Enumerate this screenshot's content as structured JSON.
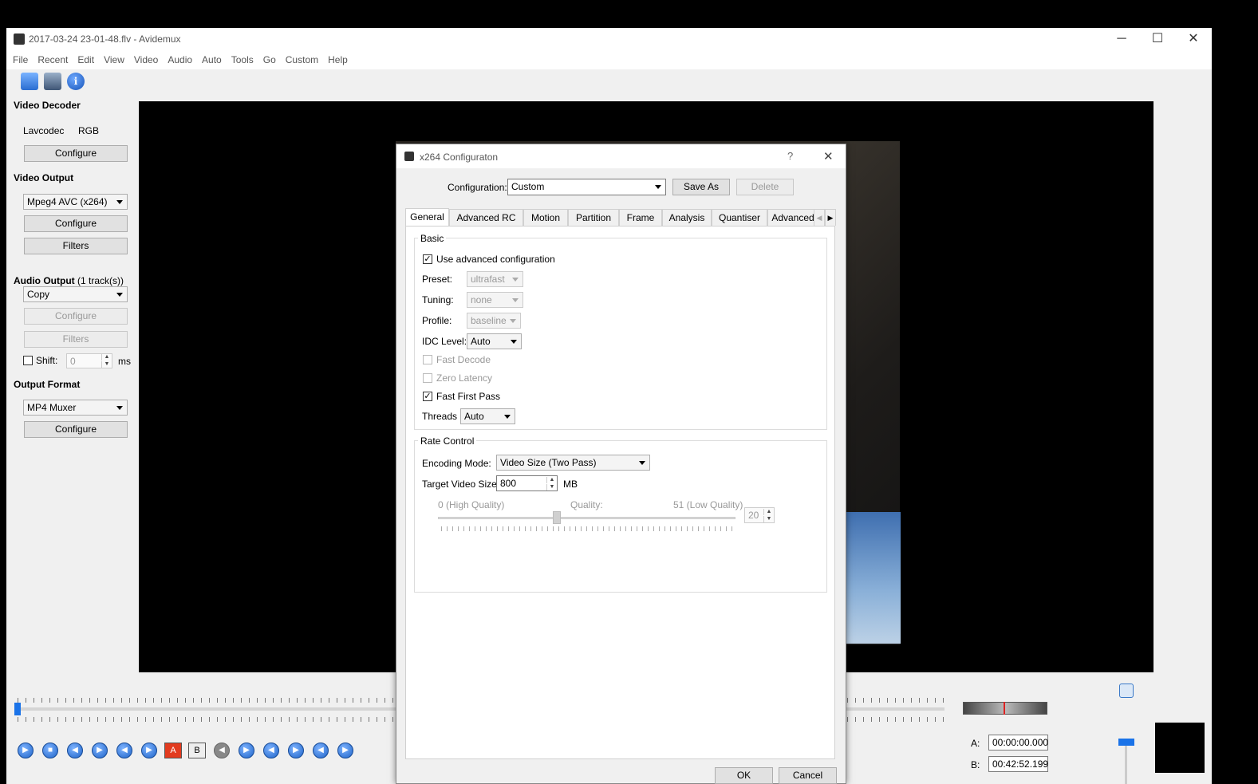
{
  "window": {
    "title": "2017-03-24 23-01-48.flv - Avidemux",
    "controls": [
      "─",
      "☐",
      "✕"
    ]
  },
  "menu": [
    "File",
    "Recent",
    "Edit",
    "View",
    "Video",
    "Audio",
    "Auto",
    "Tools",
    "Go",
    "Custom",
    "Help"
  ],
  "toolbar": {
    "icons": [
      "open-icon",
      "save-icon",
      "info-icon"
    ],
    "info_glyph": "i"
  },
  "left_panel": {
    "video_decoder": {
      "heading": "Video Decoder",
      "codec": "Lavcodec",
      "format": "RGB",
      "configure": "Configure"
    },
    "video_output": {
      "heading": "Video Output",
      "codec": "Mpeg4 AVC (x264)",
      "configure": "Configure",
      "filters": "Filters"
    },
    "audio_output": {
      "heading": "Audio Output",
      "tracks": "(1 track(s))",
      "codec": "Copy",
      "configure": "Configure",
      "filters": "Filters",
      "shift_label": "Shift:",
      "shift_value": "0",
      "shift_unit": "ms"
    },
    "output_format": {
      "heading": "Output Format",
      "muxer": "MP4 Muxer",
      "configure": "Configure"
    }
  },
  "playback": {
    "marker_a": "A",
    "marker_b": "B"
  },
  "selection": {
    "a_label": "A:",
    "a_value": "00:00:00.000",
    "b_label": "B:",
    "b_value": "00:42:52.199"
  },
  "dialog": {
    "title": "x264 Configuraton",
    "help": "?",
    "close": "✕",
    "configuration_label": "Configuration:",
    "configuration_value": "Custom",
    "save_as": "Save As",
    "delete": "Delete",
    "tabs": [
      "General",
      "Advanced RC",
      "Motion",
      "Partition",
      "Frame",
      "Analysis",
      "Quantiser",
      "Advanced"
    ],
    "active_tab": "General",
    "tab_scroll": [
      "◀",
      "▶"
    ],
    "basic": {
      "title": "Basic",
      "use_advanced": "Use advanced configuration",
      "use_advanced_checked": true,
      "preset_label": "Preset:",
      "preset_value": "ultrafast",
      "tuning_label": "Tuning:",
      "tuning_value": "none",
      "profile_label": "Profile:",
      "profile_value": "baseline",
      "idc_label": "IDC Level:",
      "idc_value": "Auto",
      "fast_decode": "Fast Decode",
      "zero_latency": "Zero Latency",
      "fast_first_pass": "Fast First Pass",
      "fast_first_pass_checked": true,
      "threads_label": "Threads",
      "threads_value": "Auto"
    },
    "rate_control": {
      "title": "Rate Control",
      "mode_label": "Encoding Mode:",
      "mode_value": "Video Size (Two Pass)",
      "target_label": "Target Video Size:",
      "target_value": "800",
      "target_unit": "MB",
      "quality_low_label": "0 (High Quality)",
      "quality_label": "Quality:",
      "quality_high_label": "51 (Low Quality)",
      "quality_value": "20",
      "quality_level": 0.4
    },
    "ok": "OK",
    "cancel": "Cancel"
  }
}
